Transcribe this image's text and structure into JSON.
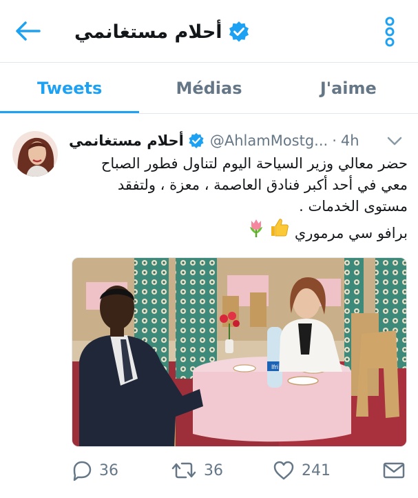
{
  "header": {
    "back_icon": "arrow-left-icon",
    "name": "أحلام مستغانمي",
    "verified_icon": "verified-badge-icon",
    "more_icon": "vertical-dots-icon"
  },
  "tabs": [
    {
      "label": "Tweets",
      "active": true
    },
    {
      "label": "Médias",
      "active": false
    },
    {
      "label": "J'aime",
      "active": false
    }
  ],
  "tweet": {
    "author_name": "أحلام مستغانمي",
    "handle": "@AhlamMostg...",
    "dot": "·",
    "time": "4h",
    "caret_icon": "chevron-down-icon",
    "text_lines": [
      "حضر معالي وزير السياحة  اليوم  لتناول فطور الصباح",
      "معي في أحد أكبر فنادق العاصمة ، معزة ، ولتفقد",
      "مستوى الخدمات ."
    ],
    "text_last": "برافو سي مرموري",
    "emojis": [
      "thumbs-up-icon",
      "tulip-icon"
    ],
    "media_alt": "photo-restaurant-table",
    "bottle_label": "Ifri",
    "actions": {
      "reply_count": "36",
      "retweet_count": "36",
      "like_count": "241"
    }
  },
  "colors": {
    "accent": "#1da1f2",
    "muted": "#657786",
    "text": "#14171a",
    "divider": "#e1e8ed"
  }
}
